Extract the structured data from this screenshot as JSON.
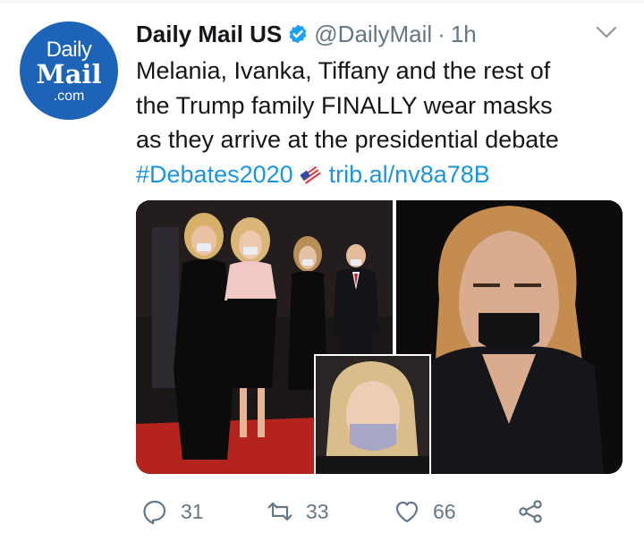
{
  "author": {
    "avatar_lines": [
      "Daily",
      "Mail",
      ".com"
    ],
    "name": "Daily Mail US",
    "handle": "@DailyMail",
    "separator": "·",
    "time": "1h"
  },
  "tweet": {
    "lines": [
      "Melania, Ivanka, Tiffany and the rest of",
      "the Trump family FINALLY wear masks",
      "as they arrive at the presidential debate"
    ],
    "hashtag": "#Debates2020",
    "url": "trib.al/nv8a78B"
  },
  "actions": {
    "replies": "31",
    "retweets": "33",
    "likes": "66"
  },
  "colors": {
    "link": "#1b95e0",
    "muted": "#657786",
    "brand": "#1d63b7"
  },
  "icons": [
    "verified-badge-icon",
    "chevron-down-icon",
    "flag-emoji-icon",
    "reply-icon",
    "retweet-icon",
    "like-icon",
    "share-icon"
  ]
}
